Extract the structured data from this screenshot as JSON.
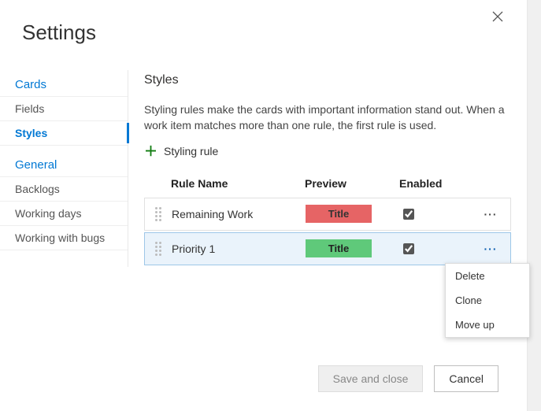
{
  "dialog": {
    "title": "Settings"
  },
  "sidebar": {
    "groups": [
      {
        "header": "Cards",
        "items": [
          {
            "label": "Fields",
            "active": false
          },
          {
            "label": "Styles",
            "active": true
          }
        ]
      },
      {
        "header": "General",
        "items": [
          {
            "label": "Backlogs",
            "active": false
          },
          {
            "label": "Working days",
            "active": false
          },
          {
            "label": "Working with bugs",
            "active": false
          }
        ]
      }
    ]
  },
  "main": {
    "section_title": "Styles",
    "description": "Styling rules make the cards with important information stand out. When a work item matches more than one rule, the first rule is used.",
    "add_rule_label": "Styling rule",
    "columns": {
      "name": "Rule Name",
      "preview": "Preview",
      "enabled": "Enabled"
    },
    "preview_chip_text": "Title",
    "rules": [
      {
        "name": "Remaining Work",
        "color": "red",
        "enabled": true,
        "selected": false
      },
      {
        "name": "Priority 1",
        "color": "green",
        "enabled": true,
        "selected": true
      }
    ]
  },
  "context_menu": {
    "items": [
      "Delete",
      "Clone",
      "Move up"
    ]
  },
  "footer": {
    "save": "Save and close",
    "cancel": "Cancel"
  }
}
